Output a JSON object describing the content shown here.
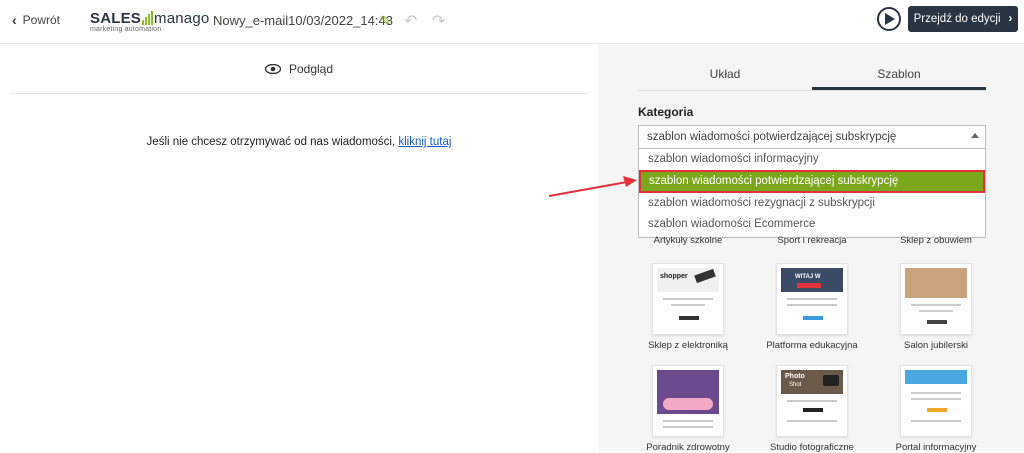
{
  "topbar": {
    "back_label": "Powrót",
    "logo_sales": "SALES",
    "logo_manago": "manago",
    "logo_sub": "marketing automation",
    "title": "Nowy_e-mail10/03/2022_14:43",
    "edit_button_label": "Przejdź do edycji"
  },
  "preview": {
    "label": "Podgląd",
    "unsub_text": "Jeśli nie chcesz otrzymywać od nas wiadomości,",
    "unsub_link": "kliknij tutaj"
  },
  "panel": {
    "tabs": [
      "Układ",
      "Szablon"
    ],
    "active_tab": "Szablon",
    "category_label": "Kategoria",
    "category_selected": "szablon wiadomości potwierdzającej subskrypcję",
    "options": [
      "szablon wiadomości informacyjny",
      "szablon wiadomości potwierdzającej subskrypcję",
      "szablon wiadomości rezygnacji z subskrypcji",
      "szablon wiadomości Ecommerce"
    ],
    "highlighted_option": "szablon wiadomości potwierdzającej subskrypcję",
    "templates_row0": [
      "Artykuły szkolne",
      "Sport i rekreacja",
      "Sklep z obuwiem"
    ],
    "templates_row1": [
      "Sklep z elektroniką",
      "Platforma edukacyjna",
      "Salon jubilerski"
    ],
    "templates_row2": [
      "Poradnik zdrowotny",
      "Studio fotograficzne",
      "Portal informacyjny"
    ],
    "thumb_text": {
      "shopper": "shopper",
      "witaj": "WITAJ W",
      "photo": "Photo",
      "shot": "Shot"
    }
  },
  "colors": {
    "navy": "#2a3544",
    "green": "#7aa71b",
    "highlight_border": "#e3323b",
    "link": "#1a5dc8"
  }
}
